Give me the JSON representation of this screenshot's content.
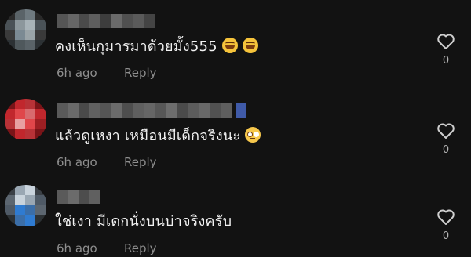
{
  "comments": [
    {
      "text": "คงเห็นกุมารมาด้วยมั้ง555",
      "emojis": [
        "laughing-tears",
        "laughing-tears"
      ],
      "time": "6h ago",
      "reply": "Reply",
      "likes": "0",
      "avatar_colors": [
        "#3a3a3a",
        "#7b8a93",
        "#4a5257",
        "#a8b3b8",
        "#2c3134",
        "#8c979c"
      ]
    },
    {
      "text": "แล้วดูเหงา เหมือนมีเด็กจริงนะ",
      "emojis": [
        "flushed-face"
      ],
      "time": "6h ago",
      "reply": "Reply",
      "likes": "0",
      "avatar_colors": [
        "#c1272d",
        "#e0464a",
        "#9d1f23",
        "#d86a6e",
        "#b83237",
        "#e8a0a2"
      ]
    },
    {
      "text": "ใช่เงา มีเดกนั่งบนบ่าจริงครับ",
      "emojis": [],
      "time": "6h ago",
      "reply": "Reply",
      "likes": "0",
      "avatar_colors": [
        "#4f5a66",
        "#2f7bd1",
        "#9aa7b3",
        "#3b6ea8",
        "#c9d3dc",
        "#5c6670"
      ]
    }
  ],
  "icons": {
    "like": "heart-outline-icon"
  }
}
